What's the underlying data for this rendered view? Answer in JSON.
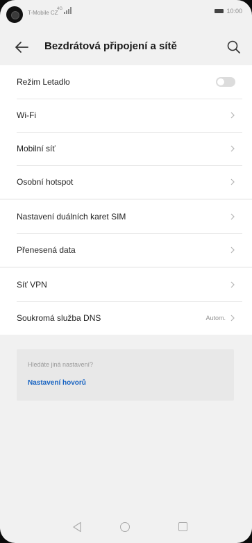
{
  "status_bar": {
    "carrier": "T-Mobile CZ",
    "network": "4G",
    "time": "10:00"
  },
  "header": {
    "title": "Bezdrátová připojení a sítě",
    "back_icon": "arrow-left-icon",
    "search_icon": "search-icon"
  },
  "groups": [
    {
      "items": [
        {
          "label": "Režim Letadlo",
          "control": "toggle",
          "toggle_on": false
        },
        {
          "label": "Wi-Fi",
          "control": "chevron"
        },
        {
          "label": "Mobilní síť",
          "control": "chevron"
        },
        {
          "label": "Osobní hotspot",
          "control": "chevron"
        }
      ]
    },
    {
      "items": [
        {
          "label": "Nastavení duálních karet SIM",
          "control": "chevron"
        },
        {
          "label": "Přenesená data",
          "control": "chevron"
        }
      ]
    },
    {
      "items": [
        {
          "label": "Síť VPN",
          "control": "chevron"
        },
        {
          "label": "Soukromá služba DNS",
          "control": "chevron",
          "value": "Autom."
        }
      ]
    }
  ],
  "suggestion_card": {
    "hint": "Hledáte jiná nastavení?",
    "link": "Nastavení hovorů"
  },
  "colors": {
    "background": "#f1f1f1",
    "card_background": "#e8e8e8",
    "link": "#1763c2",
    "toggle_off": "#dcdcdc"
  }
}
